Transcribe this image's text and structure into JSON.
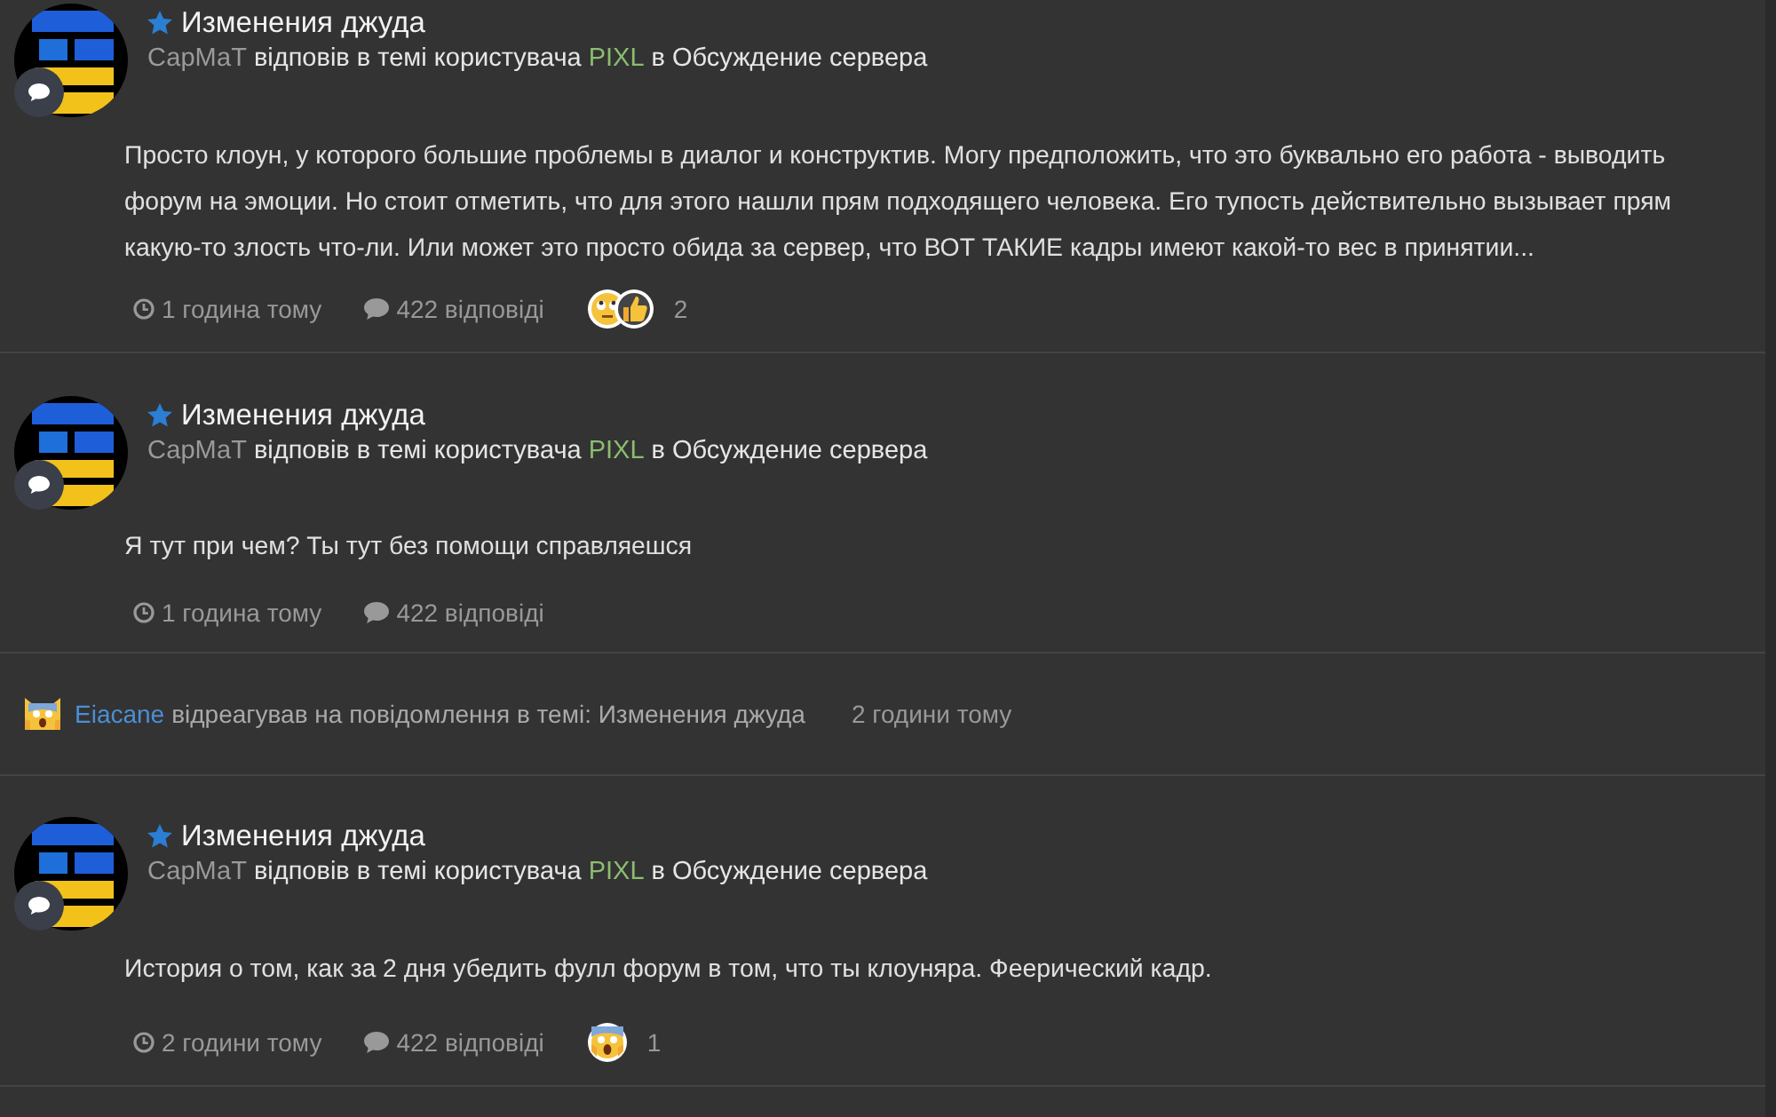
{
  "feed": [
    {
      "kind": "post",
      "starred": true,
      "title": "Изменения джуда",
      "author": "СарМаТ",
      "action": "відповів в темі користувача",
      "topic_owner": "PIXL",
      "location": "в Обсуждение сервера",
      "body": "Просто клоун, у которого большие проблемы в диалог и конструктив. Могу предположить, что это буквально его работа - выводить форум на эмоции. Но стоит отметить, что для этого нашли прям подходящего человека. Его тупость действительно вызывает прям какую-то злость что-ли. Или может это просто обида за сервер, что ВОТ ТАКИЕ кадры имеют какой-то вес в принятии...",
      "time": "1 година тому",
      "replies": "422 відповіді",
      "reactions": [
        {
          "kind": "eye-roll"
        },
        {
          "kind": "thumbs-up"
        }
      ],
      "reaction_count": "2"
    },
    {
      "kind": "post",
      "starred": true,
      "title": "Изменения джуда",
      "author": "СарМаТ",
      "action": "відповів в темі користувача",
      "topic_owner": "PIXL",
      "location": "в Обсуждение сервера",
      "body": "Я тут при чем? Ты тут без помощи справляешся",
      "time": "1 година тому",
      "replies": "422 відповіді"
    },
    {
      "kind": "reaction",
      "reactions": [
        {
          "kind": "scream-cat"
        }
      ],
      "user": "Eiacane",
      "text": "відреагував на повідомлення в темі: Изменения джуда",
      "time": "2 години тому"
    },
    {
      "kind": "post",
      "starred": true,
      "title": "Изменения джуда",
      "author": "СарМаТ",
      "action": "відповів в темі користувача",
      "topic_owner": "PIXL",
      "location": "в Обсуждение сервера",
      "body": "История о том, как за 2 дня убедить фулл форум в том, что ты клоуняра. Феерический кадр.",
      "time": "2 години тому",
      "replies": "422 відповіді",
      "reactions": [
        {
          "kind": "scream"
        }
      ],
      "reaction_count": "1"
    }
  ]
}
